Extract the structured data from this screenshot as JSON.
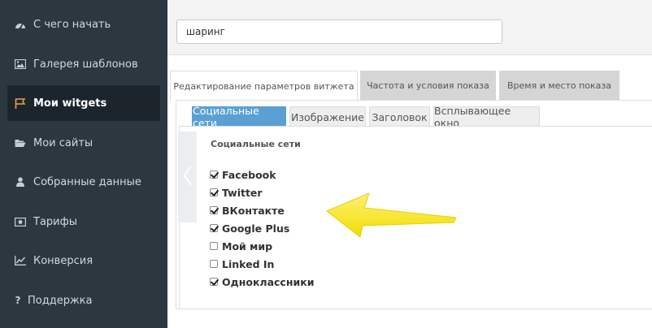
{
  "sidebar": {
    "items": [
      {
        "label": "С чего начать",
        "icon": "dashboard-icon"
      },
      {
        "label": "Галерея шаблонов",
        "icon": "image-icon"
      },
      {
        "label": "Мои witgets",
        "icon": "flag-icon",
        "active": true
      },
      {
        "label": "Мои сайты",
        "icon": "folder-open-icon"
      },
      {
        "label": "Собранные данные",
        "icon": "user-icon"
      },
      {
        "label": "Тарифы",
        "icon": "money-icon"
      },
      {
        "label": "Конверсия",
        "icon": "line-chart-icon"
      },
      {
        "label": "Поддержка",
        "icon": "question-icon"
      }
    ]
  },
  "search": {
    "value": "шаринг"
  },
  "tabs": [
    {
      "label": "Редактирование параметров витжета",
      "active": true
    },
    {
      "label": "Частота и условия показа"
    },
    {
      "label": "Время и место показа"
    }
  ],
  "subtabs": [
    {
      "label": "Социальные сети",
      "active": true
    },
    {
      "label": "Изображение"
    },
    {
      "label": "Заголовок"
    },
    {
      "label": "Всплывающее окно"
    }
  ],
  "social": {
    "title": "Социальные сети",
    "networks": [
      {
        "label": "Facebook",
        "checked": true
      },
      {
        "label": "Twitter",
        "checked": true
      },
      {
        "label": "ВКонтакте",
        "checked": true
      },
      {
        "label": "Google Plus",
        "checked": true
      },
      {
        "label": "Мой мир",
        "checked": false
      },
      {
        "label": "Linked In",
        "checked": false
      },
      {
        "label": "Одноклассники",
        "checked": true
      }
    ]
  },
  "colors": {
    "sidebar_bg": "#2c3740",
    "sidebar_active_bg": "#1c252c",
    "accent_tab": "#5aa0d2",
    "arrow": "#f5e400"
  }
}
